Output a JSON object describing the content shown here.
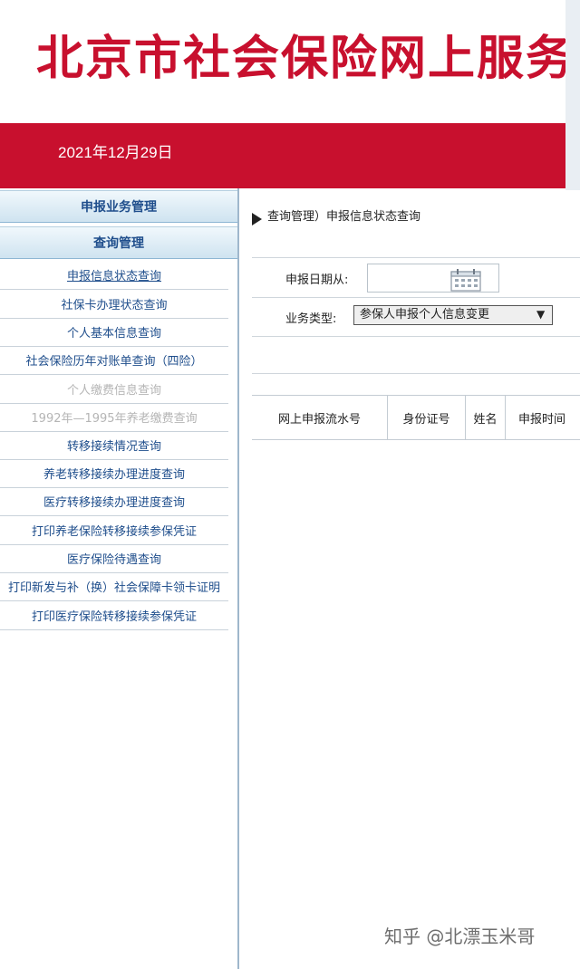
{
  "header": {
    "site_title": "北京市社会保险网上服务",
    "date": "2021年12月29日"
  },
  "sidebar": {
    "sections": [
      {
        "label": "申报业务管理"
      },
      {
        "label": "查询管理"
      }
    ],
    "items": [
      {
        "label": "申报信息状态查询"
      },
      {
        "label": "社保卡办理状态查询"
      },
      {
        "label": "个人基本信息查询"
      },
      {
        "label": "社会保险历年对账单查询（四险）"
      },
      {
        "label": "个人缴费信息查询"
      },
      {
        "label": "1992年—1995年养老缴费查询"
      },
      {
        "label": "转移接续情况查询"
      },
      {
        "label": "养老转移接续办理进度查询"
      },
      {
        "label": "医疗转移接续办理进度查询"
      },
      {
        "label": "打印养老保险转移接续参保凭证"
      },
      {
        "label": "医疗保险待遇查询"
      },
      {
        "label": "打印新发与补（换）社会保障卡领卡证明"
      },
      {
        "label": "打印医疗保险转移接续参保凭证"
      }
    ]
  },
  "main": {
    "breadcrumb": "查询管理）申报信息状态查询",
    "form": {
      "date_from_label": "申报日期从:",
      "business_type_label": "业务类型:",
      "business_type_value": "参保人申报个人信息变更"
    },
    "table": {
      "headers": [
        "网上申报流水号",
        "身份证号",
        "姓名",
        "申报时间"
      ]
    }
  },
  "watermark": "知乎 @北漂玉米哥",
  "colors": {
    "brand_red": "#c8102e",
    "link_blue": "#1f4e8c"
  }
}
